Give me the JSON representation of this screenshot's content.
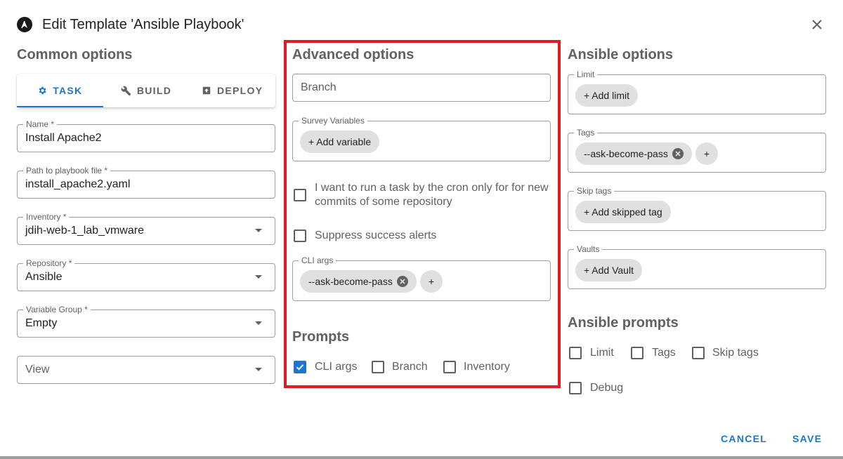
{
  "dialog": {
    "title": "Edit Template 'Ansible Playbook'",
    "logo_icon": "ansible-logo-icon",
    "close_icon": "close-icon"
  },
  "common": {
    "title": "Common options",
    "tabs": [
      {
        "label": "TASK",
        "icon": "gear-icon",
        "active": true
      },
      {
        "label": "BUILD",
        "icon": "wrench-icon",
        "active": false
      },
      {
        "label": "DEPLOY",
        "icon": "upload-box-icon",
        "active": false
      }
    ],
    "name": {
      "label": "Name *",
      "value": "Install Apache2"
    },
    "playbook": {
      "label": "Path to playbook file *",
      "value": "install_apache2.yaml"
    },
    "inventory": {
      "label": "Inventory *",
      "value": "jdih-web-1_lab_vmware"
    },
    "repository": {
      "label": "Repository *",
      "value": "Ansible"
    },
    "variable_group": {
      "label": "Variable Group *",
      "value": "Empty"
    },
    "view": {
      "placeholder": "View"
    }
  },
  "advanced": {
    "title": "Advanced options",
    "branch_placeholder": "Branch",
    "survey": {
      "label": "Survey Variables",
      "add_label": "+ Add variable"
    },
    "cron_checkbox": {
      "line1": "I want to run a task by the cron only for for new",
      "line2": "commits of some repository",
      "checked": false
    },
    "suppress_checkbox": {
      "label": "Suppress success alerts",
      "checked": false
    },
    "cli_args": {
      "label": "CLI args",
      "chip": "--ask-become-pass",
      "add": "+"
    },
    "prompts_title": "Prompts",
    "prompts": [
      {
        "label": "CLI args",
        "checked": true
      },
      {
        "label": "Branch",
        "checked": false
      },
      {
        "label": "Inventory",
        "checked": false
      }
    ]
  },
  "ansible": {
    "title": "Ansible options",
    "limit": {
      "label": "Limit",
      "add_label": "+ Add limit"
    },
    "tags": {
      "label": "Tags",
      "chip": "--ask-become-pass",
      "add": "+"
    },
    "skip_tags": {
      "label": "Skip tags",
      "add_label": "+ Add skipped tag"
    },
    "vaults": {
      "label": "Vaults",
      "add_label": "+ Add Vault"
    },
    "prompts_title": "Ansible prompts",
    "prompts": [
      {
        "label": "Limit",
        "checked": false
      },
      {
        "label": "Tags",
        "checked": false
      },
      {
        "label": "Skip tags",
        "checked": false
      },
      {
        "label": "Debug",
        "checked": false
      }
    ]
  },
  "actions": {
    "cancel": "CANCEL",
    "save": "SAVE"
  },
  "colors": {
    "accent": "#1976d2",
    "highlight": "#e01b24"
  }
}
